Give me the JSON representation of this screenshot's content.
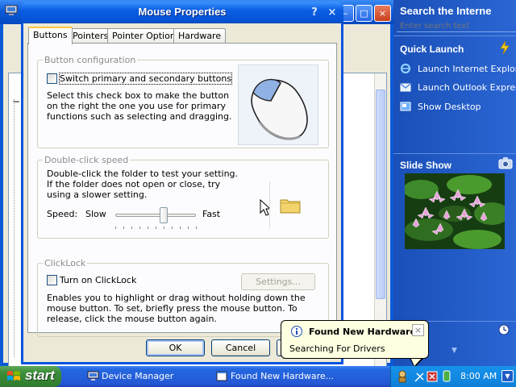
{
  "background_window": {
    "title": "Device Manager"
  },
  "dialog": {
    "title": "Mouse Properties",
    "help_glyph": "?",
    "close_glyph": "×",
    "tabs": [
      "Buttons",
      "Pointers",
      "Pointer Options",
      "Hardware"
    ],
    "active_tab": "Buttons",
    "button_config": {
      "legend": "Button configuration",
      "checkbox_label": "Switch primary and secondary buttons",
      "checked": false,
      "description": "Select this check box to make the button on the right the one you use for primary functions such as selecting and dragging."
    },
    "double_click": {
      "legend": "Double-click speed",
      "description": "Double-click the folder to test your setting. If the folder does not open or close, try using a slower setting.",
      "speed_label": "Speed:",
      "slow_label": "Slow",
      "fast_label": "Fast",
      "speed_value_fraction": 0.6
    },
    "clicklock": {
      "legend": "ClickLock",
      "checkbox_label": "Turn on ClickLock",
      "checked": false,
      "settings_button": "Settings...",
      "description": "Enables you to highlight or drag without holding down the mouse button. To set, briefly press the mouse button. To release, click the mouse button again."
    },
    "ok_button": "OK",
    "cancel_button": "Cancel"
  },
  "sidebar": {
    "search_title": "Search the Interne",
    "search_placeholder": "Enter search text",
    "quick_launch": {
      "title": "Quick Launch",
      "items": [
        "Launch Internet Explore",
        "Launch Outlook Express",
        "Show Desktop"
      ]
    },
    "slide_show": {
      "title": "Slide Show"
    }
  },
  "balloon": {
    "title": "Found New Hardware",
    "message": "Searching For Drivers",
    "close_glyph": "×"
  },
  "taskbar": {
    "start_label": "start",
    "tasks": [
      "Device Manager",
      "Found New Hardware..."
    ],
    "clock": "8:00 AM"
  },
  "colors": {
    "titlebar": "#0a5de2",
    "taskbar": "#2457d4",
    "start_button": "#3c8e3a",
    "sidebar": "#2a66d3",
    "balloon": "#ffffe1"
  }
}
